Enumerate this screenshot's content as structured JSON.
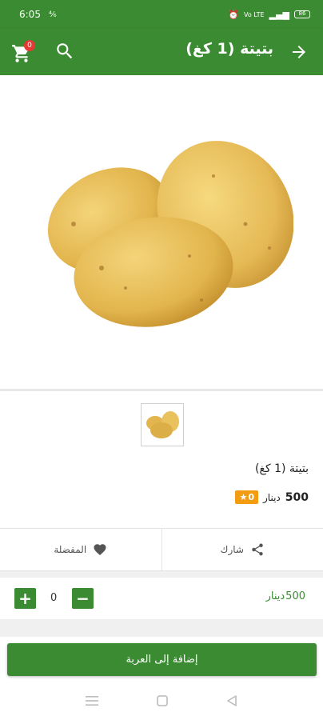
{
  "status_bar": {
    "time": "6:05",
    "signal_left": "⁴⁄₆",
    "net_label": "Vo LTE",
    "battery": "86"
  },
  "header": {
    "title": "بتيتة (1 كغ)",
    "cart_count": "0"
  },
  "product": {
    "name": "بتيتة (1 كغ)",
    "price": "500",
    "currency": "دينار",
    "rating": "0"
  },
  "actions": {
    "favorite_label": "المفضلة",
    "share_label": "شارك"
  },
  "quantity": {
    "value": "0",
    "price": "500",
    "currency": "دينار"
  },
  "add_to_cart_label": "إضافة إلى العربة",
  "colors": {
    "primary": "#3b8b32",
    "badge": "#e53935",
    "rating": "#f39c12"
  }
}
